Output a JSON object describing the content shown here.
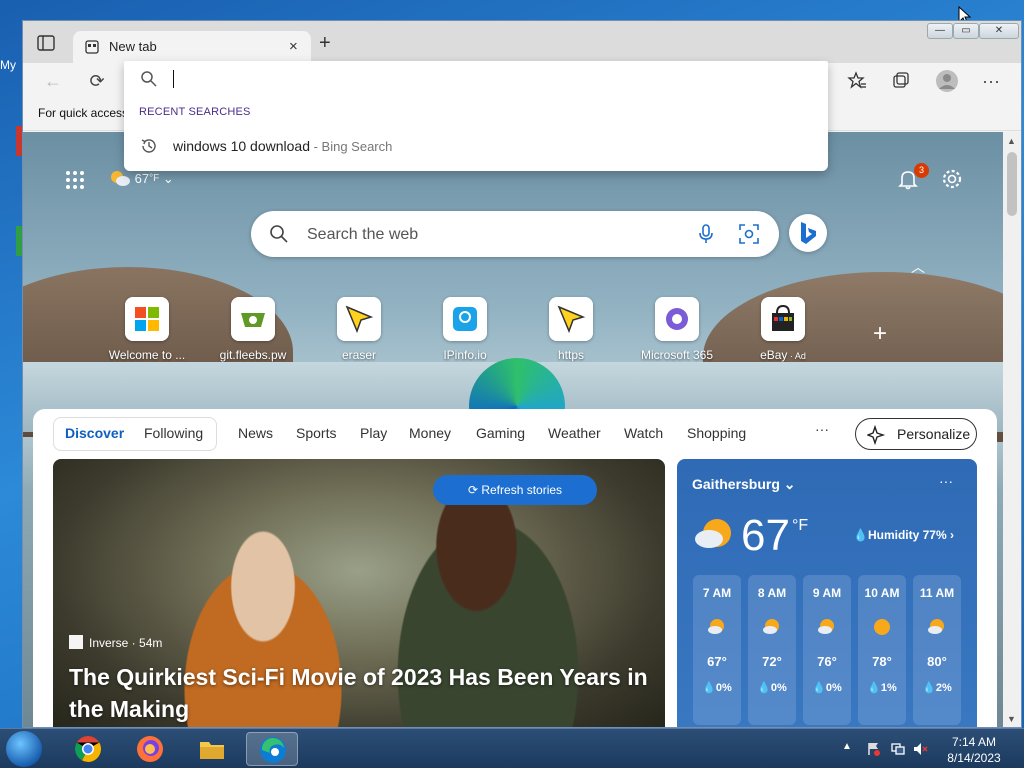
{
  "desktop": {
    "icon_label": "My"
  },
  "browser": {
    "tab": {
      "title": "New tab",
      "close": "×"
    },
    "new_tab": "+",
    "window_controls": {
      "minimize": "—",
      "maximize": "▭",
      "close": "✕"
    },
    "toolbar": {
      "back": "←",
      "refresh": "⟳",
      "more": "···"
    },
    "favorites_bar_text": "For quick access"
  },
  "address_dropdown": {
    "header": "RECENT SEARCHES",
    "items": [
      {
        "query": "windows 10 download",
        "source": " - Bing Search"
      }
    ]
  },
  "ntp": {
    "weather_temp": "67",
    "weather_unit": "°F",
    "notification_count": "3",
    "search_placeholder": "Search the web",
    "tiles": [
      {
        "label": "Welcome to ...",
        "ad": ""
      },
      {
        "label": "git.fleebs.pw",
        "ad": ""
      },
      {
        "label": "eraser",
        "ad": ""
      },
      {
        "label": "IPinfo.io",
        "ad": ""
      },
      {
        "label": "https",
        "ad": ""
      },
      {
        "label": "Microsoft 365",
        "ad": ""
      },
      {
        "label": "eBay",
        "ad": " · Ad"
      }
    ],
    "feed": {
      "nav": [
        "Discover",
        "Following",
        "News",
        "Sports",
        "Play",
        "Money",
        "Gaming",
        "Weather",
        "Watch",
        "Shopping"
      ],
      "more": "···",
      "personalize": "Personalize",
      "refresh": "Refresh stories",
      "hero": {
        "source": "Inverse · 54m",
        "headline": "The Quirkiest Sci-Fi Movie of 2023 Has Been Years in the Making"
      }
    },
    "weather_card": {
      "city": "Gaithersburg",
      "more": "···",
      "temp": "67",
      "unit": "°F",
      "humidity": "Humidity 77%",
      "hours": [
        {
          "time": "7 AM",
          "temp": "67°",
          "precip": "0%"
        },
        {
          "time": "8 AM",
          "temp": "72°",
          "precip": "0%"
        },
        {
          "time": "9 AM",
          "temp": "76°",
          "precip": "0%"
        },
        {
          "time": "10 AM",
          "temp": "78°",
          "precip": "1%"
        },
        {
          "time": "11 AM",
          "temp": "80°",
          "precip": "2%"
        }
      ]
    }
  },
  "taskbar": {
    "time": "7:14 AM",
    "date": "8/14/2023"
  },
  "colors": {
    "accent": "#1c6fd0",
    "weather_card": "#3572bd",
    "badge": "#d83b01"
  }
}
